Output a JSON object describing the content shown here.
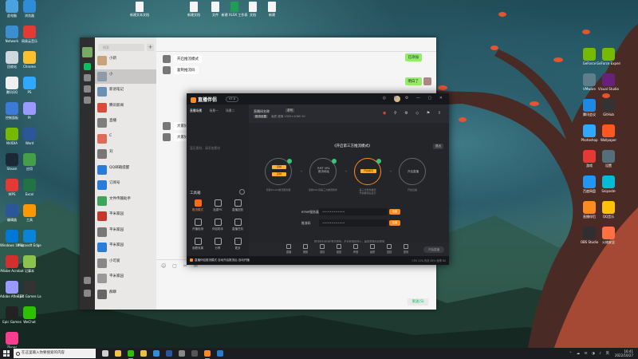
{
  "desktop": {
    "top_files": [
      {
        "label": "新建文本文档"
      },
      {
        "label": "新建文档"
      },
      {
        "label": "文件"
      },
      {
        "label": "新建 XLSX 工作表"
      },
      {
        "label": "文档"
      },
      {
        "label": "新建"
      }
    ],
    "left_icons_col1": [
      {
        "label": "此电脑",
        "color": "#4aa3df"
      },
      {
        "label": "Network",
        "color": "#3b8ed0"
      },
      {
        "label": "回收站",
        "color": "#cfd8dc"
      },
      {
        "label": "腾讯QQ",
        "color": "#f0f0f0"
      },
      {
        "label": "控制面板",
        "color": "#3a7bd5"
      },
      {
        "label": "NVIDIA",
        "color": "#76b900"
      },
      {
        "label": "Steam",
        "color": "#1b2838"
      },
      {
        "label": "WPS",
        "color": "#e53935"
      },
      {
        "label": "编辑器",
        "color": "#2b579a"
      },
      {
        "label": "Windows 10 Update Ass...",
        "color": "#0078d7"
      },
      {
        "label": "Adobe Acrobat",
        "color": "#d32f2f"
      },
      {
        "label": "Adobe After Effects",
        "color": "#9999ff"
      },
      {
        "label": "Epic Games",
        "color": "#222222"
      },
      {
        "label": "iTunes",
        "color": "#fc3c8d"
      }
    ],
    "left_icons_col2": [
      {
        "label": "浏览器",
        "color": "#2f8cd8"
      },
      {
        "label": "网易云音乐",
        "color": "#e53935"
      },
      {
        "label": "Chrome",
        "color": "#fbc02d"
      },
      {
        "label": "PS",
        "color": "#31a8ff"
      },
      {
        "label": "Pr",
        "color": "#9999ff"
      },
      {
        "label": "Word",
        "color": "#2b579a"
      },
      {
        "label": "应用",
        "color": "#43a047"
      },
      {
        "label": "Excel",
        "color": "#217346"
      },
      {
        "label": "工具",
        "color": "#ff9800"
      },
      {
        "label": "Microsoft Edge",
        "color": "#0a84d8"
      },
      {
        "label": "记事本",
        "color": "#8bc34a"
      },
      {
        "label": "Epic Games Launcher",
        "color": "#333333"
      },
      {
        "label": "WeChat",
        "color": "#2dc100"
      }
    ],
    "right_icons_col1": [
      {
        "label": "GeForce",
        "color": "#76b900"
      },
      {
        "label": "VMware",
        "color": "#607d8b"
      },
      {
        "label": "腾讯会议",
        "color": "#1e88e5"
      },
      {
        "label": "Photoshop",
        "color": "#31a8ff"
      },
      {
        "label": "游戏",
        "color": "#e53935"
      },
      {
        "label": "百度网盘",
        "color": "#2196f3"
      },
      {
        "label": "直播伴侣",
        "color": "#ff8a1f"
      },
      {
        "label": "OBS Studio",
        "color": "#302e31"
      }
    ],
    "right_icons_col2": [
      {
        "label": "GeForce Experience",
        "color": "#76b900"
      },
      {
        "label": "Visual Studio",
        "color": "#68217a"
      },
      {
        "label": "GitHub",
        "color": "#333333"
      },
      {
        "label": "Wallpaper",
        "color": "#ff5722"
      },
      {
        "label": "设置",
        "color": "#546e7a"
      },
      {
        "label": "Snipaste",
        "color": "#00bcd4"
      },
      {
        "label": "QQ音乐",
        "color": "#ffc107"
      },
      {
        "label": "火绒安全",
        "color": "#ff7043"
      }
    ]
  },
  "wechat": {
    "search_placeholder": "搜索",
    "chat_title": "",
    "contacts": [
      {
        "name": "小新",
        "preview": "",
        "time": "",
        "color": "#c8a27a"
      },
      {
        "name": "小",
        "preview": "",
        "time": "",
        "color": "#8d9ba8",
        "selected": true
      },
      {
        "name": "新语笔记",
        "preview": "",
        "time": "",
        "color": "#6a8fb5"
      },
      {
        "name": "腾讯新闻",
        "preview": "",
        "time": "",
        "color": "#d94b3a"
      },
      {
        "name": "直播",
        "preview": "",
        "time": "",
        "color": "#7d7d7d"
      },
      {
        "name": "C",
        "preview": "",
        "time": "",
        "color": "#e06a5a"
      },
      {
        "name": "刘",
        "preview": "",
        "time": "",
        "color": "#777777"
      },
      {
        "name": "QQ邮箱提醒",
        "preview": "",
        "time": "",
        "color": "#2b7bd8"
      },
      {
        "name": "订阅号",
        "preview": "",
        "time": "",
        "color": "#2b7bd8"
      },
      {
        "name": "文件传输助手",
        "preview": "",
        "time": "",
        "color": "#3fa35a"
      },
      {
        "name": "平米家园",
        "preview": "",
        "time": "",
        "color": "#c0392b"
      },
      {
        "name": "平米家园",
        "preview": "",
        "time": "",
        "color": "#777777"
      },
      {
        "name": "平米家园",
        "preview": "",
        "time": "",
        "color": "#2b7bd8"
      },
      {
        "name": "小可爱",
        "preview": "",
        "time": "",
        "color": "#888888"
      },
      {
        "name": "平米家园",
        "preview": "",
        "time": "",
        "color": "#999999"
      },
      {
        "name": "群聊",
        "preview": "",
        "time": "",
        "color": "#666666"
      }
    ],
    "messages": [
      {
        "side": "l",
        "text": "开启推流模式"
      },
      {
        "side": "l",
        "text": "复制推流码"
      },
      {
        "side": "r",
        "text": "已添加"
      },
      {
        "side": "r",
        "text": "明白了"
      },
      {
        "side": "l",
        "text": "大家好"
      },
      {
        "side": "l",
        "text": "大家好"
      }
    ],
    "send_label": "发送(S)"
  },
  "stream_app": {
    "app_name": "直播伴侣",
    "version_badge": "V7.0",
    "left_tabs": [
      "直播场景",
      "场景一",
      "场景二"
    ],
    "empty_hint": "暂无素材，请添加素材",
    "toolbox_title": "工具箱",
    "tools": [
      {
        "label": "推流模式",
        "hot": true
      },
      {
        "label": "连麦PK"
      },
      {
        "label": "直播回放"
      },
      {
        "label": "开播检测"
      },
      {
        "label": "伴侣助手"
      },
      {
        "label": "直播任务"
      },
      {
        "label": "观看效果"
      },
      {
        "label": "分享"
      },
      {
        "label": "更多"
      }
    ],
    "room_title": "直播间名称",
    "room_tag": "游戏",
    "meta_chip": "推流设置",
    "meta_text": "画质 超清  1920×1080  20",
    "guide_title": "《开启第三方推流模式》",
    "exit_label": "退出",
    "steps": [
      {
        "num": "1",
        "label": "",
        "caption": "获取Studio推流服务器",
        "buttons": [
          "复制",
          "复制"
        ]
      },
      {
        "num": "2",
        "label": "RMT URL\n推流地址",
        "caption": "复制URL到第三方推流软件"
      },
      {
        "num": "3",
        "label": "",
        "caption": "第三方软件推流\n开启推流后显示",
        "buttons": [
          "开启推流"
        ]
      },
      {
        "num": "4",
        "label": "",
        "caption": "开启直播"
      }
    ],
    "server_label": "RTMP服务器",
    "server_value": "••••••••••••",
    "key_label": "推流码",
    "key_value": "••••••••••••",
    "copy_label": "复制",
    "note": "推流码为RTMP推流密码，不可泄露给他人，每场直播自动更新",
    "bottom_tools": [
      "直播",
      "美颜",
      "道具",
      "贴纸",
      "声音",
      "画质",
      "连线",
      "音效"
    ],
    "start_label": "开始直播",
    "status_left": "直播间",
    "status_text": "直播伴侣推流模式 自动开启推流后 自动开播",
    "status_right": "CPU 11%  内存 65%  帧率 60"
  },
  "taskbar": {
    "search_placeholder": "在这里输入你要搜索的内容",
    "apps": [
      {
        "name": "Task View",
        "color": "#cfcfcf"
      },
      {
        "name": "Explorer",
        "color": "#f4c542"
      },
      {
        "name": "WeChat",
        "color": "#2dc100",
        "open": true
      },
      {
        "name": "Chrome",
        "color": "#e8c33b"
      },
      {
        "name": "Edge",
        "color": "#2f8ee0"
      },
      {
        "name": "Word",
        "color": "#2b579a"
      },
      {
        "name": "Photos",
        "color": "#888888"
      },
      {
        "name": "Terminal",
        "color": "#555555"
      },
      {
        "name": "直播伴侣",
        "color": "#ff8a1f",
        "open": true
      },
      {
        "name": "Store",
        "color": "#2a7bd0"
      }
    ],
    "time": "16:41",
    "date": "2022/10/27"
  }
}
